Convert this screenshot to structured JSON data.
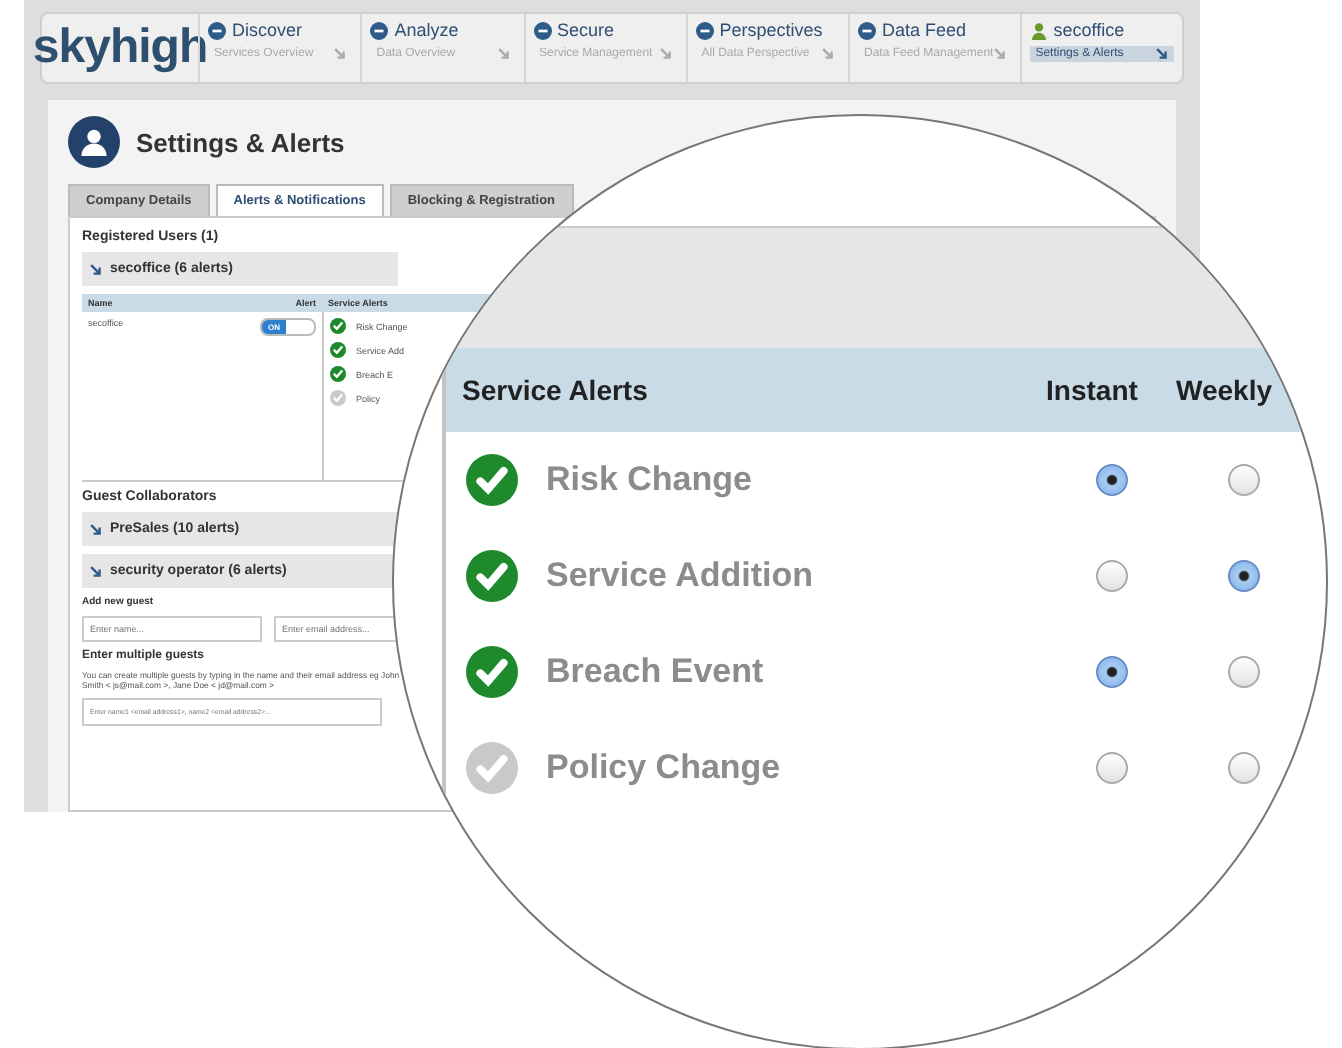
{
  "nav": {
    "logo": "skyhigh",
    "items": [
      {
        "kind": "discover",
        "title": "Discover",
        "subtitle": "Services Overview",
        "selected": false
      },
      {
        "kind": "analyze",
        "title": "Analyze",
        "subtitle": "Data Overview",
        "selected": false
      },
      {
        "kind": "secure",
        "title": "Secure",
        "subtitle": "Service Management",
        "selected": false
      },
      {
        "kind": "perspectives",
        "title": "Perspectives",
        "subtitle": "All Data Perspective",
        "selected": false
      },
      {
        "kind": "datafeed",
        "title": "Data Feed",
        "subtitle": "Data Feed Management",
        "selected": false
      },
      {
        "kind": "user",
        "title": "secoffice",
        "subtitle": "Settings & Alerts",
        "selected": true
      }
    ]
  },
  "page": {
    "title": "Settings & Alerts"
  },
  "tabs": [
    {
      "label": "Company Details",
      "selected": false
    },
    {
      "label": "Alerts & Notifications",
      "selected": true
    },
    {
      "label": "Blocking & Registration",
      "selected": false
    }
  ],
  "registered": {
    "heading": "Registered Users (1)",
    "group": "secoffice (6 alerts)",
    "columns": [
      "Name",
      "Alert",
      "Service Alerts"
    ],
    "user": "secoffice",
    "toggle": {
      "label": "ON",
      "on": true
    },
    "alerts": [
      {
        "name": "Risk Change",
        "enabled": true
      },
      {
        "name": "Service Add",
        "enabled": true
      },
      {
        "name": "Breach E",
        "enabled": true
      },
      {
        "name": "Policy",
        "enabled": false
      }
    ]
  },
  "guests": {
    "heading": "Guest Collaborators",
    "groups": [
      "PreSales (10 alerts)",
      "security operator (6 alerts)"
    ],
    "add_label": "Add new guest",
    "name_field": {
      "placeholder": "Enter name..."
    },
    "email_field": {
      "placeholder": "Enter email address..."
    },
    "multi_heading": "Enter multiple guests",
    "multi_help": "You can create multiple guests by typing in the name and their email address eg John Smith < js@mail.com >, Jane Doe < jd@mail.com >",
    "multi_field": {
      "placeholder": "Enter name1 <email address1>, name2 <email address2>..."
    }
  },
  "magnifier": {
    "columns": [
      "Service Alerts",
      "Instant",
      "Weekly"
    ],
    "rows": [
      {
        "name": "Risk Change",
        "enabled": true,
        "instant": true,
        "weekly": false
      },
      {
        "name": "Service Addition",
        "enabled": true,
        "instant": false,
        "weekly": true
      },
      {
        "name": "Breach Event",
        "enabled": true,
        "instant": true,
        "weekly": false
      },
      {
        "name": "Policy Change",
        "enabled": false,
        "instant": false,
        "weekly": false
      }
    ]
  }
}
